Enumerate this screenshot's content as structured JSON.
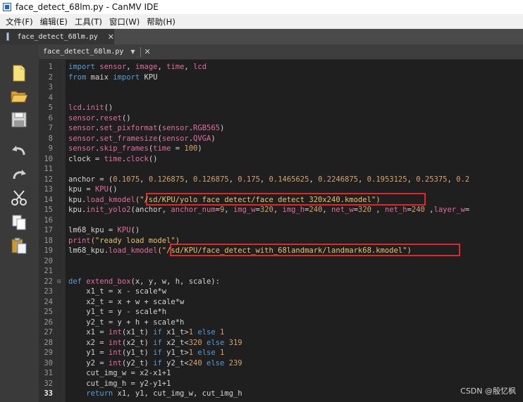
{
  "window": {
    "title": "face_detect_68lm.py - CanMV IDE"
  },
  "menu": [
    "文件(F)",
    "编辑(E)",
    "工具(T)",
    "窗口(W)",
    "帮助(H)"
  ],
  "tab": {
    "label": "face_detect_68lm.py",
    "close": "✕"
  },
  "editor": {
    "filename": "face_detect_68lm.py",
    "dropdown": "▼",
    "close": "✕"
  },
  "code_lines": [
    {
      "n": "1",
      "segs": [
        [
          "kw",
          "import"
        ],
        [
          "nm",
          " "
        ],
        [
          "fn",
          "sensor"
        ],
        [
          "nm",
          ", "
        ],
        [
          "fn",
          "image"
        ],
        [
          "nm",
          ", "
        ],
        [
          "fn",
          "time"
        ],
        [
          "nm",
          ", "
        ],
        [
          "fn",
          "lcd"
        ]
      ]
    },
    {
      "n": "2",
      "segs": [
        [
          "kw",
          "from"
        ],
        [
          "nm",
          " maix "
        ],
        [
          "kw",
          "import"
        ],
        [
          "nm",
          " KPU"
        ]
      ]
    },
    {
      "n": "3",
      "segs": []
    },
    {
      "n": "4",
      "segs": []
    },
    {
      "n": "5",
      "segs": [
        [
          "fn",
          "lcd"
        ],
        [
          "nm",
          "."
        ],
        [
          "fn",
          "init"
        ],
        [
          "nm",
          "()"
        ]
      ]
    },
    {
      "n": "6",
      "segs": [
        [
          "fn",
          "sensor"
        ],
        [
          "nm",
          "."
        ],
        [
          "fn",
          "reset"
        ],
        [
          "nm",
          "()"
        ]
      ]
    },
    {
      "n": "7",
      "segs": [
        [
          "fn",
          "sensor"
        ],
        [
          "nm",
          "."
        ],
        [
          "fn",
          "set_pixformat"
        ],
        [
          "nm",
          "("
        ],
        [
          "fn",
          "sensor"
        ],
        [
          "nm",
          "."
        ],
        [
          "fn",
          "RGB565"
        ],
        [
          "nm",
          ")"
        ]
      ]
    },
    {
      "n": "8",
      "segs": [
        [
          "fn",
          "sensor"
        ],
        [
          "nm",
          "."
        ],
        [
          "fn",
          "set_framesize"
        ],
        [
          "nm",
          "("
        ],
        [
          "fn",
          "sensor"
        ],
        [
          "nm",
          "."
        ],
        [
          "fn",
          "QVGA"
        ],
        [
          "nm",
          ")"
        ]
      ]
    },
    {
      "n": "9",
      "segs": [
        [
          "fn",
          "sensor"
        ],
        [
          "nm",
          "."
        ],
        [
          "fn",
          "skip_frames"
        ],
        [
          "nm",
          "("
        ],
        [
          "fn",
          "time"
        ],
        [
          "nm",
          " = "
        ],
        [
          "nu",
          "100"
        ],
        [
          "nm",
          ")"
        ]
      ]
    },
    {
      "n": "10",
      "segs": [
        [
          "nm",
          "clock = "
        ],
        [
          "fn",
          "time"
        ],
        [
          "nm",
          "."
        ],
        [
          "fn",
          "clock"
        ],
        [
          "nm",
          "()"
        ]
      ]
    },
    {
      "n": "11",
      "segs": []
    },
    {
      "n": "12",
      "segs": [
        [
          "nm",
          "anchor = ("
        ],
        [
          "nu",
          "0.1075"
        ],
        [
          "nm",
          ", "
        ],
        [
          "nu",
          "0.126875"
        ],
        [
          "nm",
          ", "
        ],
        [
          "nu",
          "0.126875"
        ],
        [
          "nm",
          ", "
        ],
        [
          "nu",
          "0.175"
        ],
        [
          "nm",
          ", "
        ],
        [
          "nu",
          "0.1465625"
        ],
        [
          "nm",
          ", "
        ],
        [
          "nu",
          "0.2246875"
        ],
        [
          "nm",
          ", "
        ],
        [
          "nu",
          "0.1953125"
        ],
        [
          "nm",
          ", "
        ],
        [
          "nu",
          "0.25375"
        ],
        [
          "nm",
          ", "
        ],
        [
          "nu",
          "0.2"
        ]
      ]
    },
    {
      "n": "13",
      "segs": [
        [
          "nm",
          "kpu = "
        ],
        [
          "fn",
          "KPU"
        ],
        [
          "nm",
          "()"
        ]
      ]
    },
    {
      "n": "14",
      "segs": [
        [
          "nm",
          "kpu."
        ],
        [
          "fn",
          "load_kmodel"
        ],
        [
          "st",
          "(\"/sd/KPU/yolo face detect/face detect 320x240.kmodel\")"
        ]
      ]
    },
    {
      "n": "15",
      "segs": [
        [
          "nm",
          "kpu."
        ],
        [
          "fn",
          "init_yolo2"
        ],
        [
          "nm",
          "(anchor, "
        ],
        [
          "fn",
          "anchor_num"
        ],
        [
          "nm",
          "="
        ],
        [
          "nu",
          "9"
        ],
        [
          "nm",
          ", "
        ],
        [
          "fn",
          "img_w"
        ],
        [
          "nm",
          "="
        ],
        [
          "nu",
          "320"
        ],
        [
          "nm",
          ", "
        ],
        [
          "fn",
          "img_h"
        ],
        [
          "nm",
          "="
        ],
        [
          "nu",
          "240"
        ],
        [
          "nm",
          ", "
        ],
        [
          "fn",
          "net_w"
        ],
        [
          "nm",
          "="
        ],
        [
          "nu",
          "320"
        ],
        [
          "nm",
          " , "
        ],
        [
          "fn",
          "net_h"
        ],
        [
          "nm",
          "="
        ],
        [
          "nu",
          "240"
        ],
        [
          "nm",
          " ,"
        ],
        [
          "fn",
          "layer_w"
        ],
        [
          "nm",
          "="
        ]
      ]
    },
    {
      "n": "16",
      "segs": []
    },
    {
      "n": "17",
      "segs": [
        [
          "nm",
          "lm68_kpu = "
        ],
        [
          "fn",
          "KPU"
        ],
        [
          "nm",
          "()"
        ]
      ]
    },
    {
      "n": "18",
      "segs": [
        [
          "fn",
          "print"
        ],
        [
          "st",
          "(\"ready load model\")"
        ]
      ]
    },
    {
      "n": "19",
      "segs": [
        [
          "nm",
          "lm68_kpu."
        ],
        [
          "fn",
          "load_kmodel"
        ],
        [
          "st",
          "(\"/sd/KPU/face_detect_with_68landmark/landmark68.kmodel\")"
        ]
      ]
    },
    {
      "n": "20",
      "segs": []
    },
    {
      "n": "21",
      "segs": []
    },
    {
      "n": "22",
      "segs": [
        [
          "kw",
          "def"
        ],
        [
          "nm",
          " "
        ],
        [
          "fn",
          "extend_box"
        ],
        [
          "nm",
          "(x, y, w, h, scale):"
        ]
      ]
    },
    {
      "n": "23",
      "segs": [
        [
          "nm",
          "    x1_t = x - scale*w"
        ]
      ]
    },
    {
      "n": "24",
      "segs": [
        [
          "nm",
          "    x2_t = x + w + scale*w"
        ]
      ]
    },
    {
      "n": "25",
      "segs": [
        [
          "nm",
          "    y1_t = y - scale*h"
        ]
      ]
    },
    {
      "n": "26",
      "segs": [
        [
          "nm",
          "    y2_t = y + h + scale*h"
        ]
      ]
    },
    {
      "n": "27",
      "segs": [
        [
          "nm",
          "    x1 = "
        ],
        [
          "fn",
          "int"
        ],
        [
          "nm",
          "(x1_t) "
        ],
        [
          "kw",
          "if"
        ],
        [
          "nm",
          " x1_t>"
        ],
        [
          "nu",
          "1"
        ],
        [
          "nm",
          " "
        ],
        [
          "kw",
          "else"
        ],
        [
          "nm",
          " "
        ],
        [
          "nu",
          "1"
        ]
      ]
    },
    {
      "n": "28",
      "segs": [
        [
          "nm",
          "    x2 = "
        ],
        [
          "fn",
          "int"
        ],
        [
          "nm",
          "(x2_t) "
        ],
        [
          "kw",
          "if"
        ],
        [
          "nm",
          " x2_t<"
        ],
        [
          "nu",
          "320"
        ],
        [
          "nm",
          " "
        ],
        [
          "kw",
          "else"
        ],
        [
          "nm",
          " "
        ],
        [
          "nu",
          "319"
        ]
      ]
    },
    {
      "n": "29",
      "segs": [
        [
          "nm",
          "    y1 = "
        ],
        [
          "fn",
          "int"
        ],
        [
          "nm",
          "(y1_t) "
        ],
        [
          "kw",
          "if"
        ],
        [
          "nm",
          " y1_t>"
        ],
        [
          "nu",
          "1"
        ],
        [
          "nm",
          " "
        ],
        [
          "kw",
          "else"
        ],
        [
          "nm",
          " "
        ],
        [
          "nu",
          "1"
        ]
      ]
    },
    {
      "n": "30",
      "segs": [
        [
          "nm",
          "    y2 = "
        ],
        [
          "fn",
          "int"
        ],
        [
          "nm",
          "(y2_t) "
        ],
        [
          "kw",
          "if"
        ],
        [
          "nm",
          " y2_t<"
        ],
        [
          "nu",
          "240"
        ],
        [
          "nm",
          " "
        ],
        [
          "kw",
          "else"
        ],
        [
          "nm",
          " "
        ],
        [
          "nu",
          "239"
        ]
      ]
    },
    {
      "n": "31",
      "segs": [
        [
          "nm",
          "    cut_img_w = x2-x1+1"
        ]
      ]
    },
    {
      "n": "32",
      "segs": [
        [
          "nm",
          "    cut_img_h = y2-y1+1"
        ]
      ]
    },
    {
      "n": "33",
      "segs": [
        [
          "kw",
          "    return"
        ],
        [
          "nm",
          " x1, y1, cut_img_w, cut_img_h"
        ]
      ]
    }
  ],
  "current_line": "33",
  "watermark": "CSDN @殷忆枫",
  "colors": {
    "highlight_box": "#e02828",
    "editor_bg": "#1f1f1f"
  }
}
